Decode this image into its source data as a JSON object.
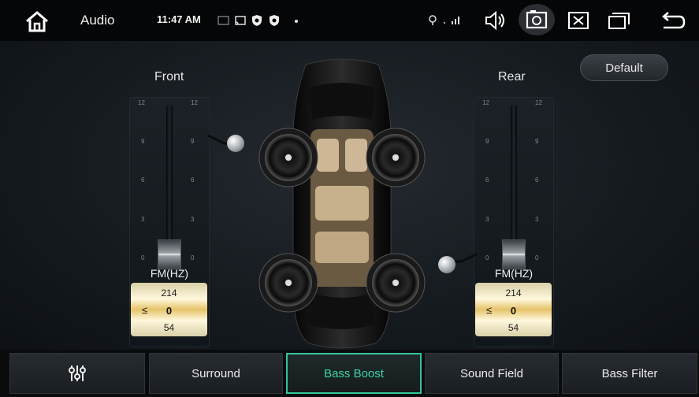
{
  "status_bar": {
    "app_title": "Audio",
    "time": "11:47 AM",
    "icons": [
      "home-icon",
      "cast-icon",
      "shield-icon",
      "shield-icon",
      "dot-icon",
      "location-icon",
      "signal-icon",
      "volume-icon",
      "screenshot-icon",
      "close-window-icon",
      "multitask-icon",
      "back-icon"
    ]
  },
  "main": {
    "default_label": "Default",
    "front": {
      "label": "Front",
      "ticks": [
        "12",
        "9",
        "6",
        "3",
        "0"
      ],
      "level": 0,
      "freq_label": "FM(HZ)",
      "freq_values": [
        "214",
        "0",
        "54"
      ],
      "freq_symbol": "≤"
    },
    "rear": {
      "label": "Rear",
      "ticks": [
        "12",
        "9",
        "6",
        "3",
        "0"
      ],
      "level": 0,
      "freq_label": "FM(HZ)",
      "freq_values": [
        "214",
        "0",
        "54"
      ],
      "freq_symbol": "≤"
    }
  },
  "tabs": [
    {
      "label": "",
      "icon": "equalizer-icon"
    },
    {
      "label": "Surround"
    },
    {
      "label": "Bass Boost",
      "active": true
    },
    {
      "label": "Sound Field"
    },
    {
      "label": "Bass Filter"
    }
  ],
  "colors": {
    "accent": "#35c49a",
    "background": "#161b20",
    "freq_box": "#e6c36a"
  }
}
